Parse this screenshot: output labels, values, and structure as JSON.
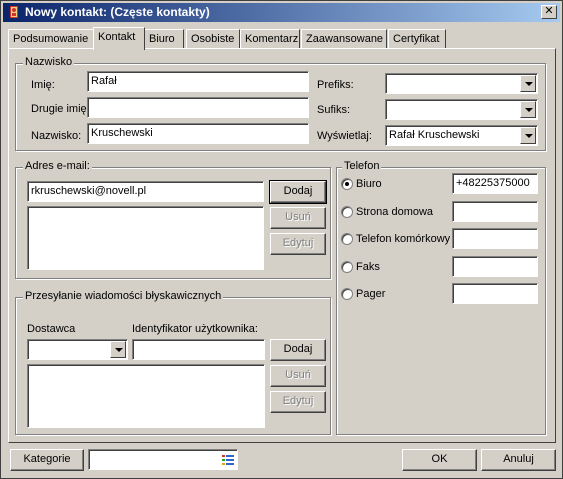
{
  "window": {
    "title": "Nowy kontakt:  (Częste kontakty)",
    "close_label": "✕"
  },
  "tabs": [
    {
      "label": "Podsumowanie"
    },
    {
      "label": "Kontakt"
    },
    {
      "label": "Biuro"
    },
    {
      "label": "Osobiste"
    },
    {
      "label": "Komentarz"
    },
    {
      "label": "Zaawansowane"
    },
    {
      "label": "Certyfikat"
    }
  ],
  "name_group": {
    "legend": "Nazwisko",
    "first_label": "Imię:",
    "first_value": "Rafał",
    "middle_label": "Drugie imię:",
    "middle_value": "",
    "last_label": "Nazwisko:",
    "last_value": "Kruschewski",
    "prefix_label": "Prefiks:",
    "prefix_value": "",
    "suffix_label": "Sufiks:",
    "suffix_value": "",
    "display_label": "Wyświetlaj:",
    "display_value": "Rafał Kruschewski"
  },
  "email_group": {
    "legend": "Adres e-mail:",
    "input_value": "rkruschewski@novell.pl",
    "add_label": "Dodaj",
    "remove_label": "Usuń",
    "edit_label": "Edytuj"
  },
  "im_group": {
    "legend": "Przesyłanie wiadomości błyskawicznych",
    "provider_label": "Dostawca",
    "provider_value": "",
    "user_id_label": "Identyfikator użytkownika:",
    "user_id_value": "",
    "add_label": "Dodaj",
    "remove_label": "Usuń",
    "edit_label": "Edytuj"
  },
  "phone_group": {
    "legend": "Telefon",
    "options": [
      {
        "label": "Biuro",
        "value": "+48225375000",
        "selected": true
      },
      {
        "label": "Strona domowa",
        "value": ""
      },
      {
        "label": "Telefon komórkowy",
        "value": ""
      },
      {
        "label": "Faks",
        "value": ""
      },
      {
        "label": "Pager",
        "value": ""
      }
    ]
  },
  "footer": {
    "categories_label": "Kategorie",
    "categories_value": "",
    "ok_label": "OK",
    "cancel_label": "Anuluj"
  }
}
